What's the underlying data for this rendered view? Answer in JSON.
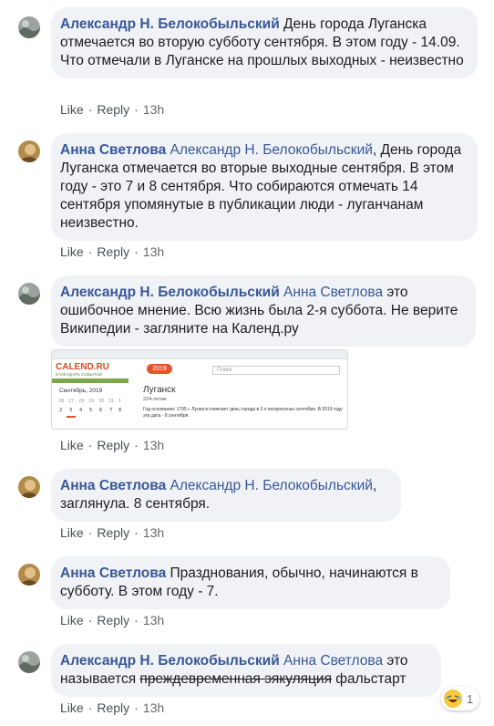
{
  "actions": {
    "like": "Like",
    "reply": "Reply",
    "dot": "·"
  },
  "comments": [
    {
      "author": "Александр Н. Белокобыльский",
      "text": " День города Луганска отмечается во вторую субботу сентября. В этом году - 14.09. Что отмечали в Луганске на прошлых выходных - неизвестно",
      "time": "13h"
    },
    {
      "author": "Анна Светлова",
      "mention": "Александр Н. Белокобыльский",
      "text": ", День города Луганска отмечается во вторые выходные сентября. В этом году - это 7 и 8 сентября. Что собираются отмечать 14 сентября упомянутые в публикации люди - луганчанам неизвестно.",
      "time": "13h"
    },
    {
      "author": "Александр Н. Белокобыльский",
      "mention": "Анна Светлова",
      "text": " это ошибочное мнение. Всю жизнь была 2-я суббота. Не верите Википедии - загляните на Календ.ру",
      "time": "13h",
      "preview": {
        "logo": "CALEND.RU",
        "logo_sub": "КАЛЕНДАРЬ СОБЫТИЙ",
        "year_badge": "2019",
        "search_placeholder": "Поиск",
        "month": "Сентябрь, 2019",
        "city": "Луганск",
        "age": "224-летие",
        "desc": "Год основания: 1795 г. Луганск отмечает день города в 2-е воскресенье сентября. В 2019 году эта дата - 8 сентября."
      }
    },
    {
      "author": "Анна Светлова",
      "mention": "Александр Н. Белокобыльский",
      "text": ", заглянула. 8 сентября.",
      "time": "13h"
    },
    {
      "author": "Анна Светлова",
      "text": " Празднования, обычно, начинаются в субботу. В этом году - 7.",
      "time": "13h"
    },
    {
      "author": "Александр Н. Белокобыльский",
      "mention": "Анна Светлова",
      "text": " это называется ",
      "struck": "преждевременная эякуляция",
      "text_after": " фальстарт",
      "time": "13h",
      "reaction_icon": "laughing-emoji-icon",
      "reaction_count": "1"
    }
  ]
}
